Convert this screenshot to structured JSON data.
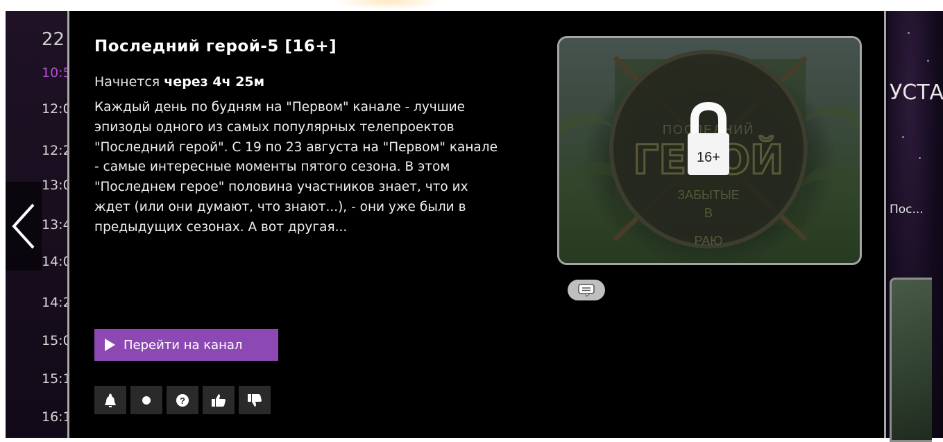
{
  "schedule": {
    "date_day": "22",
    "times": [
      "10:5",
      "12:0",
      "12:2",
      "13:0",
      "13:4",
      "14:0",
      "14:2",
      "15:0",
      "15:1",
      "16:1"
    ]
  },
  "right_panel": {
    "title_fragment": "УСТА",
    "item_fragment": "Пос..."
  },
  "program": {
    "title": "Последний герой-5 [16+]",
    "starts_prefix": "Начнется",
    "starts_in": "через 4ч 25м",
    "description": "Каждый день по будням на \"Первом\" канале - лучшие эпизоды одного из самых популярных телепроектов \"Последний герой\". С 19 по 23 августа на \"Первом\" канале - самые интересные моменты пятого сезона. В этом \"Последнем герое\" половина участников знает, что их ждет (или они думают, что знают...), - они уже были в предыдущих сезонах. А вот другая..."
  },
  "actions": {
    "go_to_channel_label": "Перейти на канал",
    "icon_buttons": [
      "bell-icon",
      "record-icon",
      "help-icon",
      "thumbs-up-icon",
      "thumbs-down-icon"
    ]
  },
  "poster": {
    "logo_top": "ПОСЛЕДНИЙ",
    "logo_main": "ГЕРОЙ",
    "logo_sub_1": "ЗАБЫТЫЕ",
    "logo_sub_2": "В",
    "logo_sub_3": "РАЮ",
    "age_rating": "16+"
  },
  "colors": {
    "accent": "#8d49b3",
    "active_time": "#b84bd6",
    "modal_bg": "#000000"
  }
}
